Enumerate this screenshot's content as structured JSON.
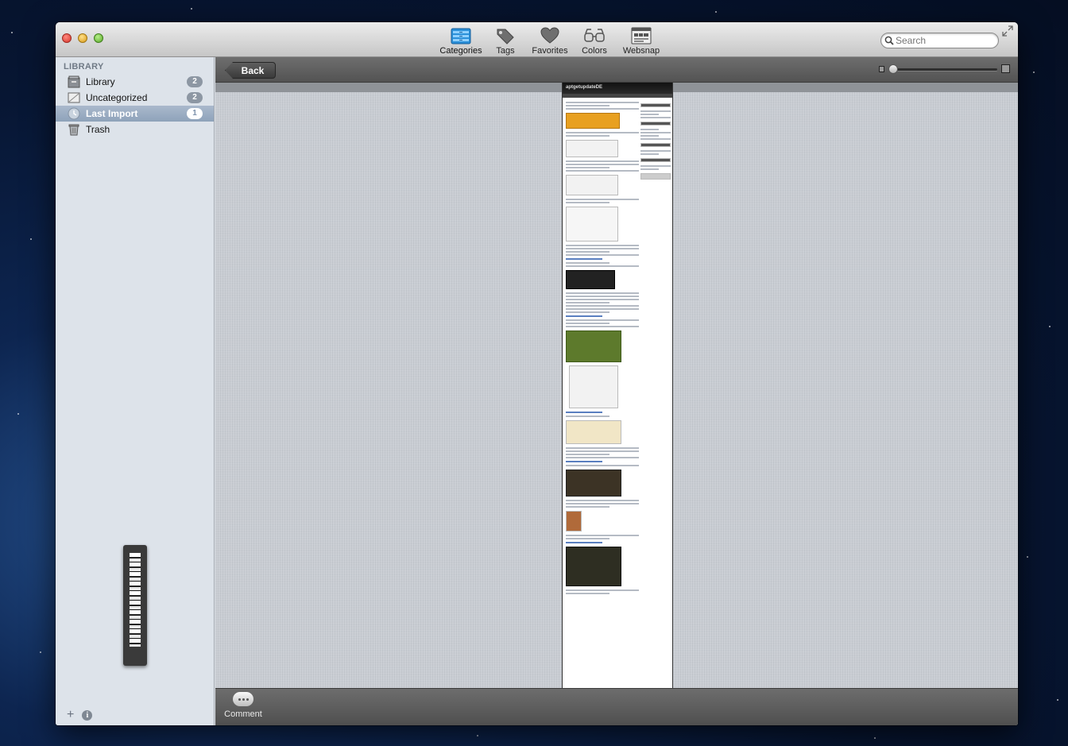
{
  "toolbar": {
    "items": [
      {
        "label": "Categories",
        "icon": "categories-icon"
      },
      {
        "label": "Tags",
        "icon": "tag-icon"
      },
      {
        "label": "Favorites",
        "icon": "heart-icon"
      },
      {
        "label": "Colors",
        "icon": "glasses-icon"
      },
      {
        "label": "Websnap",
        "icon": "websnap-icon"
      }
    ],
    "active": "Categories",
    "accent_color": "#2a8fd8"
  },
  "search": {
    "placeholder": "Search"
  },
  "sidebar": {
    "header": "LIBRARY",
    "items": [
      {
        "label": "Library",
        "count": "2",
        "icon": "library-icon"
      },
      {
        "label": "Uncategorized",
        "count": "2",
        "icon": "uncategorized-icon"
      },
      {
        "label": "Last Import",
        "count": "1",
        "icon": "clock-icon",
        "selected": true
      },
      {
        "label": "Trash",
        "count": "",
        "icon": "trash-icon"
      }
    ]
  },
  "navbar": {
    "back_label": "Back"
  },
  "websnap_preview": {
    "site_title": "aptgetupdateDE"
  },
  "footer": {
    "comment_label": "Comment"
  }
}
